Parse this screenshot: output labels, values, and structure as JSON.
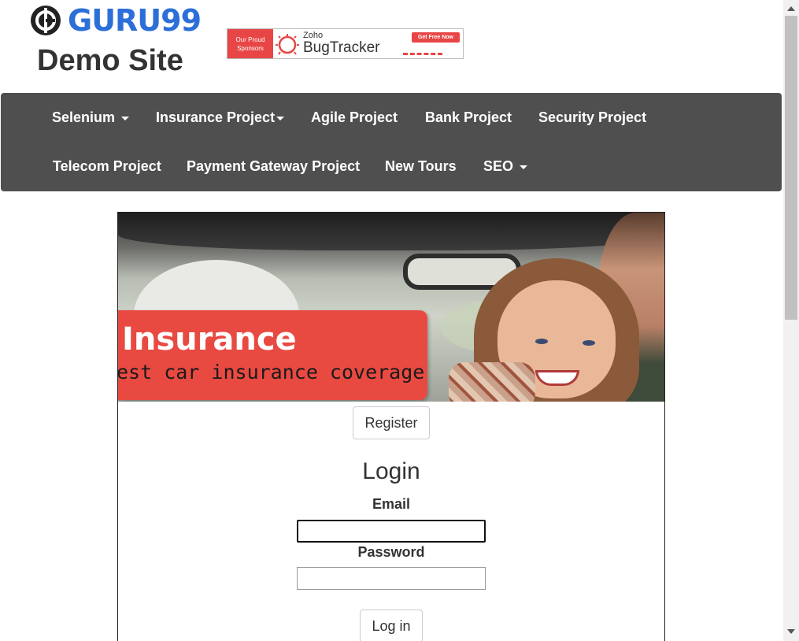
{
  "header": {
    "logo_text": "GURU99",
    "site_title": "Demo Site",
    "ad": {
      "left_text": "Our Proud Sponsors",
      "brand_small": "Zoho",
      "brand_large": "BugTracker",
      "cta": "Get Free Now"
    }
  },
  "nav": {
    "row1": [
      {
        "label": "Selenium",
        "dropdown": true
      },
      {
        "label": "Insurance Project",
        "dropdown": true
      },
      {
        "label": "Agile Project",
        "dropdown": false
      },
      {
        "label": "Bank Project",
        "dropdown": false
      },
      {
        "label": "Security Project",
        "dropdown": false
      }
    ],
    "row2": [
      {
        "label": "Telecom Project",
        "dropdown": false
      },
      {
        "label": "Payment Gateway Project",
        "dropdown": false
      },
      {
        "label": "New Tours",
        "dropdown": false
      },
      {
        "label": "SEO",
        "dropdown": true
      }
    ]
  },
  "hero": {
    "title": "Insurance",
    "subtitle": "est car insurance coverage"
  },
  "register_label": "Register",
  "login": {
    "title": "Login",
    "email_label": "Email",
    "email_value": "",
    "password_label": "Password",
    "password_value": "",
    "submit_label": "Log in"
  },
  "colors": {
    "brand_blue": "#2c6fd8",
    "navbar_bg": "#4f4f4f",
    "accent_red": "#e84a42"
  }
}
